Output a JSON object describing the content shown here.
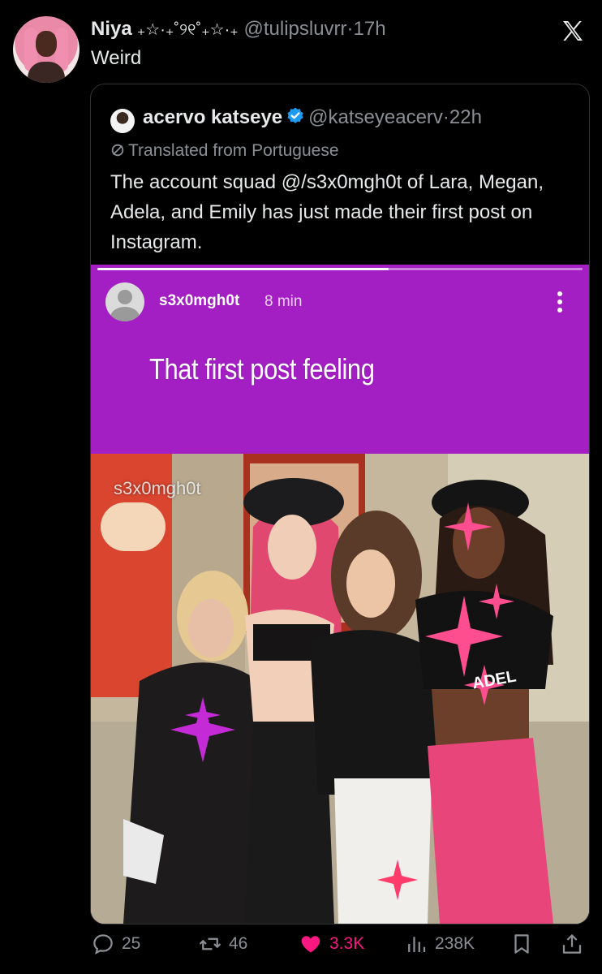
{
  "tweet": {
    "author_name": "Niya",
    "name_decoration": "₊☆·₊˚୨୧˚₊☆·₊",
    "handle": "@tulipsluvrr",
    "time": "17h",
    "text": "Weird"
  },
  "quote": {
    "author_name": "acervo katseye",
    "handle": "@katseyeacerv",
    "time": "22h",
    "translated_label": "Translated from Portuguese",
    "text": "The account squad @/s3x0mgh0t of Lara, Megan, Adela, and Emily has just made their first post on Instagram."
  },
  "story": {
    "username": "s3x0mgh0t",
    "time": "8 min",
    "caption": "That first post feeling",
    "watermark": "s3x0mgh0t",
    "progress": 0.6,
    "background_color": "#a31fc3",
    "jacket_text": "ADEL"
  },
  "actions": {
    "replies": "25",
    "reposts": "46",
    "likes": "3.3K",
    "views": "238K",
    "like_color": "#f91880"
  }
}
